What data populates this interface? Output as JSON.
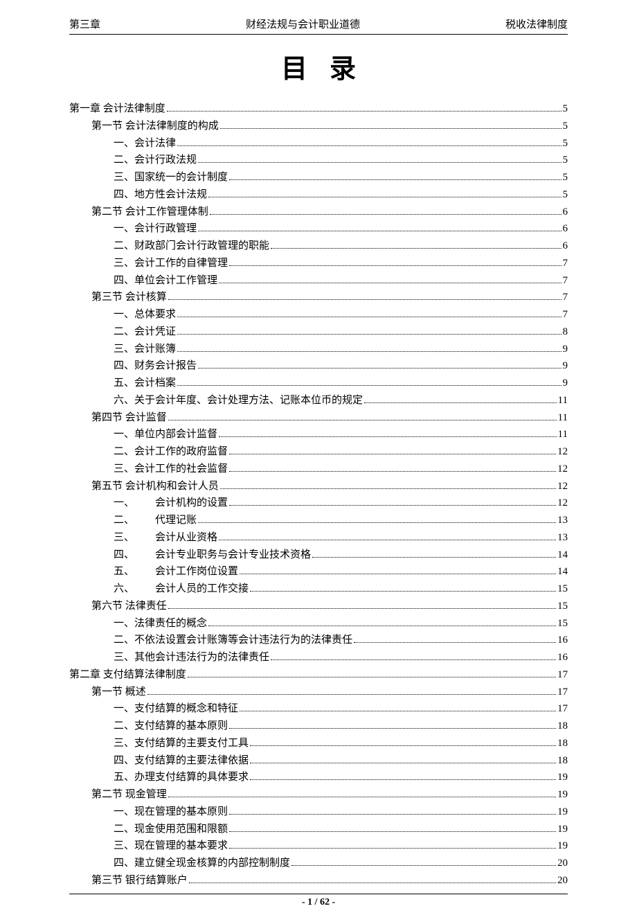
{
  "header": {
    "left": "第三章",
    "center": "财经法规与会计职业道德",
    "right": "税收法律制度"
  },
  "title": "目录",
  "footer": "- 1 / 62 -",
  "toc": [
    {
      "level": 0,
      "label": "第一章 会计法律制度",
      "page": "5"
    },
    {
      "level": 1,
      "label": "第一节 会计法律制度的构成",
      "page": "5"
    },
    {
      "level": 2,
      "label": "一、会计法律",
      "page": "5"
    },
    {
      "level": 2,
      "label": "二、会计行政法规",
      "page": "5"
    },
    {
      "level": 2,
      "label": "三、国家统一的会计制度",
      "page": "5"
    },
    {
      "level": 2,
      "label": "四、地方性会计法规",
      "page": "5"
    },
    {
      "level": 1,
      "label": "第二节 会计工作管理体制",
      "page": "6"
    },
    {
      "level": 2,
      "label": "一、会计行政管理",
      "page": "6"
    },
    {
      "level": 2,
      "label": "二、财政部门会计行政管理的职能",
      "page": "6"
    },
    {
      "level": 2,
      "label": "三、会计工作的自律管理",
      "page": "7"
    },
    {
      "level": 2,
      "label": "四、单位会计工作管理",
      "page": "7"
    },
    {
      "level": 1,
      "label": "第三节 会计核算",
      "page": "7"
    },
    {
      "level": 2,
      "label": "一、总体要求",
      "page": "7"
    },
    {
      "level": 2,
      "label": "二、会计凭证",
      "page": "8"
    },
    {
      "level": 2,
      "label": "三、会计账簿",
      "page": "9"
    },
    {
      "level": 2,
      "label": "四、财务会计报告",
      "page": "9"
    },
    {
      "level": 2,
      "label": "五、会计档案",
      "page": "9"
    },
    {
      "level": 2,
      "label": "六、关于会计年度、会计处理方法、记账本位币的规定",
      "page": "11"
    },
    {
      "level": 1,
      "label": "第四节 会计监督",
      "page": "11"
    },
    {
      "level": 2,
      "label": "一、单位内部会计监督",
      "page": "11"
    },
    {
      "level": 2,
      "label": "二、会计工作的政府监督",
      "page": "12"
    },
    {
      "level": 2,
      "label": "三、会计工作的社会监督",
      "page": "12"
    },
    {
      "level": 1,
      "label": "第五节 会计机构和会计人员",
      "page": "12"
    },
    {
      "level": "2b",
      "num": "一、",
      "label": "会计机构的设置",
      "page": "12"
    },
    {
      "level": "2b",
      "num": "二、",
      "label": "代理记账",
      "page": "13"
    },
    {
      "level": "2b",
      "num": "三、",
      "label": "会计从业资格",
      "page": "13"
    },
    {
      "level": "2b",
      "num": "四、",
      "label": "会计专业职务与会计专业技术资格",
      "page": "14"
    },
    {
      "level": "2b",
      "num": "五、",
      "label": "会计工作岗位设置",
      "page": "14"
    },
    {
      "level": "2b",
      "num": "六、",
      "label": "会计人员的工作交接",
      "page": "15"
    },
    {
      "level": 1,
      "label": "第六节 法律责任",
      "page": "15"
    },
    {
      "level": 2,
      "label": "一、法律责任的概念",
      "page": "15"
    },
    {
      "level": 2,
      "label": "二、不依法设置会计账簿等会计违法行为的法律责任",
      "page": "16"
    },
    {
      "level": 2,
      "label": "三、其他会计违法行为的法律责任",
      "page": "16"
    },
    {
      "level": 0,
      "label": "第二章 支付结算法律制度",
      "page": "17"
    },
    {
      "level": 1,
      "label": "第一节 概述",
      "page": "17"
    },
    {
      "level": 2,
      "label": "一、支付结算的概念和特征",
      "page": "17"
    },
    {
      "level": 2,
      "label": "二、支付结算的基本原则",
      "page": "18"
    },
    {
      "level": 2,
      "label": "三、支付结算的主要支付工具",
      "page": "18"
    },
    {
      "level": 2,
      "label": "四、支付结算的主要法律依据",
      "page": "18"
    },
    {
      "level": 2,
      "label": "五、办理支付结算的具体要求",
      "page": "19"
    },
    {
      "level": 1,
      "label": "第二节 现金管理",
      "page": "19"
    },
    {
      "level": 2,
      "label": "一、现在管理的基本原则",
      "page": "19"
    },
    {
      "level": 2,
      "label": "二、现金使用范围和限额",
      "page": "19"
    },
    {
      "level": 2,
      "label": "三、现在管理的基本要求",
      "page": "19"
    },
    {
      "level": 2,
      "label": "四、建立健全现金核算的内部控制制度",
      "page": "20"
    },
    {
      "level": 1,
      "label": "第三节 银行结算账户",
      "page": "20"
    }
  ]
}
